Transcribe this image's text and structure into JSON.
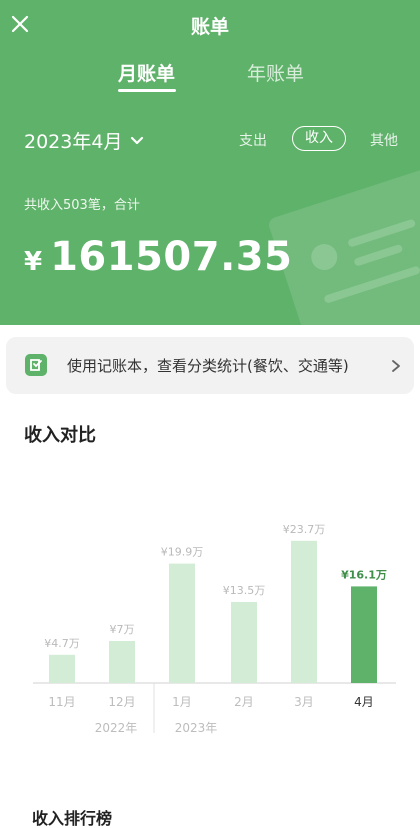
{
  "header": {
    "title": "账单",
    "tabs": [
      {
        "label": "月账单",
        "active": true
      },
      {
        "label": "年账单",
        "active": false
      }
    ],
    "month_selector": "2023年4月",
    "filters": {
      "expense": "支出",
      "income": "收入",
      "other": "其他",
      "active": "收入"
    },
    "summary": "共收入503笔，合计",
    "currency": "¥",
    "amount": "161507.35",
    "bg_color": "#5fb26a"
  },
  "banner": {
    "text": "使用记账本，查看分类统计(餐饮、交通等)",
    "icon": "ledger-icon"
  },
  "comparison": {
    "title": "收入对比"
  },
  "chart_data": {
    "type": "bar",
    "categories": [
      "11月",
      "12月",
      "1月",
      "2月",
      "3月",
      "4月"
    ],
    "values": [
      4.7,
      7,
      19.9,
      13.5,
      23.7,
      16.1
    ],
    "value_labels": [
      "¥4.7万",
      "¥7万",
      "¥19.9万",
      "¥13.5万",
      "¥23.7万",
      "¥16.1万"
    ],
    "year_labels": [
      "2022年",
      "2023年"
    ],
    "highlight_index": 5,
    "ylim": [
      0,
      25
    ],
    "colors": {
      "normal": "#d3ecd6",
      "highlight": "#5fb26a"
    }
  },
  "ranking": {
    "title": "收入排行榜"
  }
}
